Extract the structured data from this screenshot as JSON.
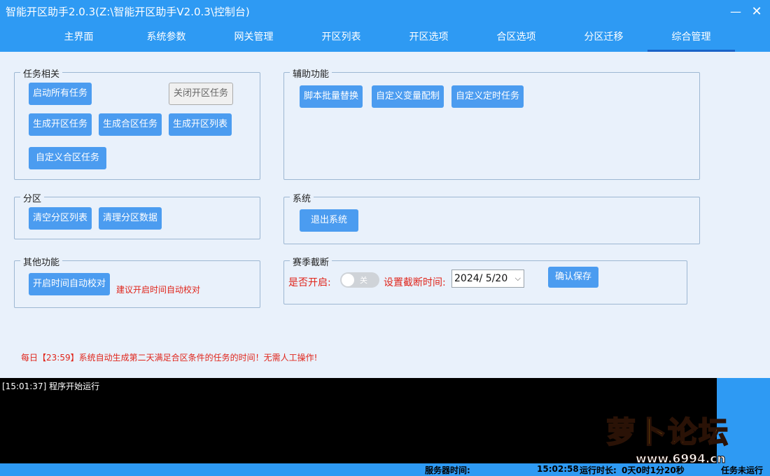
{
  "window": {
    "title": "智能开区助手2.0.3(Z:\\智能开区助手V2.0.3\\控制台)",
    "min_glyph": "—",
    "close_glyph": "✕"
  },
  "tabs": [
    {
      "label": "主界面"
    },
    {
      "label": "系统参数"
    },
    {
      "label": "网关管理"
    },
    {
      "label": "开区列表"
    },
    {
      "label": "开区选项"
    },
    {
      "label": "合区选项"
    },
    {
      "label": "分区迁移"
    },
    {
      "label": "综合管理"
    }
  ],
  "active_tab": "综合管理",
  "task": {
    "label": "任务相关",
    "start_all": "启动所有任务",
    "close_open": "关闭开区任务",
    "gen_open": "生成开区任务",
    "gen_merge": "生成合区任务",
    "gen_open_list": "生成开区列表",
    "custom_merge": "自定义合区任务"
  },
  "aux": {
    "label": "辅助功能",
    "script_replace": "脚本批量替换",
    "custom_var": "自定义变量配制",
    "custom_timer": "自定义定时任务"
  },
  "partition": {
    "label": "分区",
    "clear_list": "清空分区列表",
    "clean_data": "清理分区数据"
  },
  "system": {
    "label": "系统",
    "exit": "退出系统"
  },
  "other": {
    "label": "其他功能",
    "auto_time": "开启时间自动校对",
    "hint": "建议开启时间自动校对"
  },
  "season": {
    "label": "赛季截断",
    "enable_label": "是否开启:",
    "toggle_text": "关",
    "time_label": "设置截断时间:",
    "date_value": "2024/  5/20",
    "date_arrow": "⌵",
    "save": "确认保存"
  },
  "footer_note": "每日【23:59】系统自动生成第二天满足合区条件的任务的时间！无需人工操作!",
  "console": {
    "lines": [
      "[15:01:37] 程序开始运行"
    ]
  },
  "status": {
    "server_time_label": "服务器时间:",
    "server_time": "15:02:58",
    "runtime_label": "运行时长:",
    "runtime_value": "0天0时1分20秒",
    "task_status": "任务未运行"
  },
  "watermark": {
    "text": "萝卜论坛",
    "url": "www.6994.cn"
  },
  "colors": {
    "accent": "#2e9af3",
    "button": "#4b9cf0",
    "warn": "#e0251b"
  }
}
